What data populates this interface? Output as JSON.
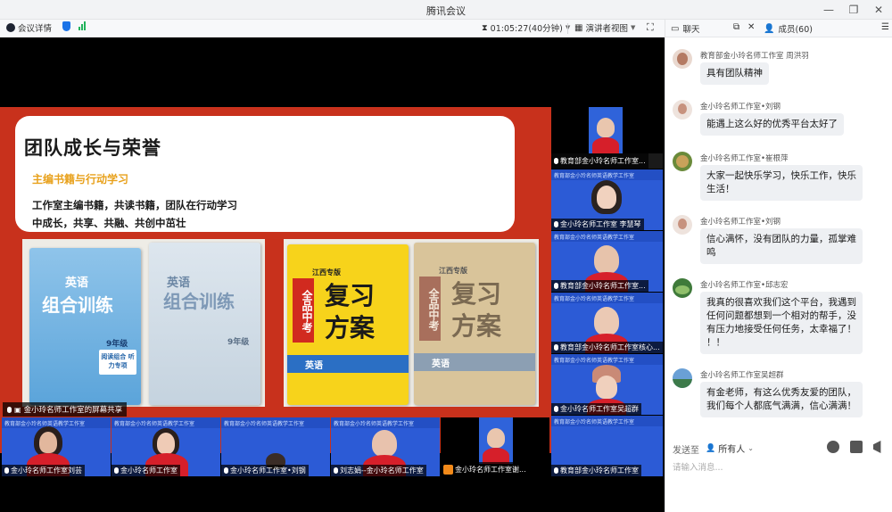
{
  "window": {
    "title": "腾讯会议"
  },
  "toolbar": {
    "meeting_info": "会议详情",
    "timer": "01:05:27(40分钟)",
    "view_mode": "演讲者视图"
  },
  "slide": {
    "title": "团队成长与荣誉",
    "subtitle": "主编书籍与行动学习",
    "body_line1": "工作室主编书籍，共读书籍，团队在行动学习",
    "body_line2": "中成长，共享、共融、共创中茁壮",
    "book1_title": "英语",
    "book1_subtitle": "组合训练",
    "book1_grade": "9年级",
    "book1_tag": "阅读组合 听力专项",
    "book2_title": "英语",
    "book2_subtitle": "组合训练",
    "book2_grade": "9年级",
    "book3_region": "江西专版",
    "book3_side": "全品中考",
    "book3_title": "复习",
    "book3_title2": "方案",
    "book3_band": "英语",
    "book4_region": "江西专版",
    "book4_side": "全品中考",
    "book4_title": "复习",
    "book4_title2": "方案",
    "book4_band": "英语"
  },
  "screen_share_label": "金小玲名师工作室的屏幕共享",
  "tile_banner": "教育部金小玲名师英语教学工作室",
  "right_tiles": [
    {
      "label": "教育部金小玲名师工作室..."
    },
    {
      "label": "金小玲名师工作室 李慧琴"
    },
    {
      "label": "教育部金小玲名师工作室..."
    },
    {
      "label": "教育部金小玲名师工作室核心..."
    },
    {
      "label": "金小玲名师工作室吴超群"
    },
    {
      "label": "教育部金小玲名师工作室"
    }
  ],
  "bottom_tiles": [
    {
      "label": "金小玲名师工作室刘芸"
    },
    {
      "label": "金小玲名师工作室"
    },
    {
      "label": "金小玲名师工作室•刘钢"
    },
    {
      "label": "刘志娟--金小玲名师工作室"
    },
    {
      "label": "金小玲名师工作室谢..."
    }
  ],
  "chat": {
    "tab_chat": "聊天",
    "tab_members": "成员(60)",
    "messages": [
      {
        "sender": "教育部金小玲名师工作室 周洪羽",
        "text": "具有团队精神"
      },
      {
        "sender": "金小玲名师工作室•刘钢",
        "text": "能遇上这么好的优秀平台太好了"
      },
      {
        "sender": "金小玲名师工作室•崔根萍",
        "text_line1": "大家一起快乐学习，快乐工作，快乐",
        "text_line2": "生活！"
      },
      {
        "sender": "金小玲名师工作室•刘钢",
        "text_line1": "信心满怀，没有团队的力量，孤掌难",
        "text_line2": "鸣"
      },
      {
        "sender": "金小玲名师工作室•邱志宏",
        "text_line1": "我真的很喜欢我们这个平台，我遇到",
        "text_line2": "任何问题都想到一个相对的帮手，没",
        "text_line3": "有压力地接受任何任务，太幸福了！",
        "text_line4": "！！"
      },
      {
        "sender": "金小玲名师工作室吴超群",
        "text_line1": "有金老师，有这么优秀友爱的团队，",
        "text_line2": "我们每个人都底气满满，信心满满！"
      }
    ],
    "send_to_label": "发送至",
    "send_target": "所有人",
    "input_placeholder": "请输入消息..."
  },
  "colors": {
    "stage_bg": "#000000",
    "slide_red": "#c8311c",
    "tile_blue": "#2c5bd6",
    "accent_orange": "#e8a11c"
  }
}
